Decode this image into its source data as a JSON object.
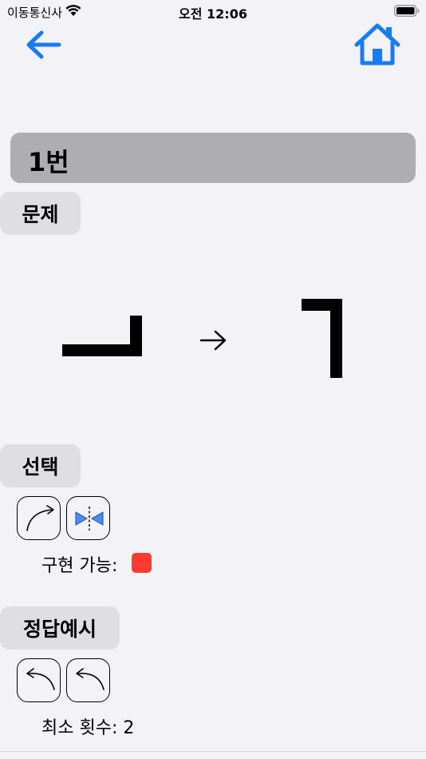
{
  "status_bar": {
    "carrier": "이동통신사",
    "time": "오전 12:06"
  },
  "nav": {
    "back_icon": "arrow-left-icon",
    "home_icon": "house-icon",
    "accent_color": "#1a7cf5"
  },
  "title": "1번",
  "sections": {
    "problem": "문제",
    "choice": "선택",
    "answer_example": "정답예시"
  },
  "problem": {
    "from_glyph": "ㅢ-rotated-shape",
    "arrow_icon": "arrow-right-icon",
    "to_glyph": "ㄱ-shape"
  },
  "choice_ops": [
    "rotate-clockwise-icon",
    "mirror-horizontal-icon"
  ],
  "possible": {
    "label": "구현 가능:",
    "indicator_color": "#ff3b30"
  },
  "answer_ops": [
    "rotate-counterclockwise-icon",
    "rotate-counterclockwise-icon"
  ],
  "min_count": {
    "label": "최소 횟수:",
    "value": "2"
  },
  "colors": {
    "mirror_fill": "#4a8ef0"
  }
}
